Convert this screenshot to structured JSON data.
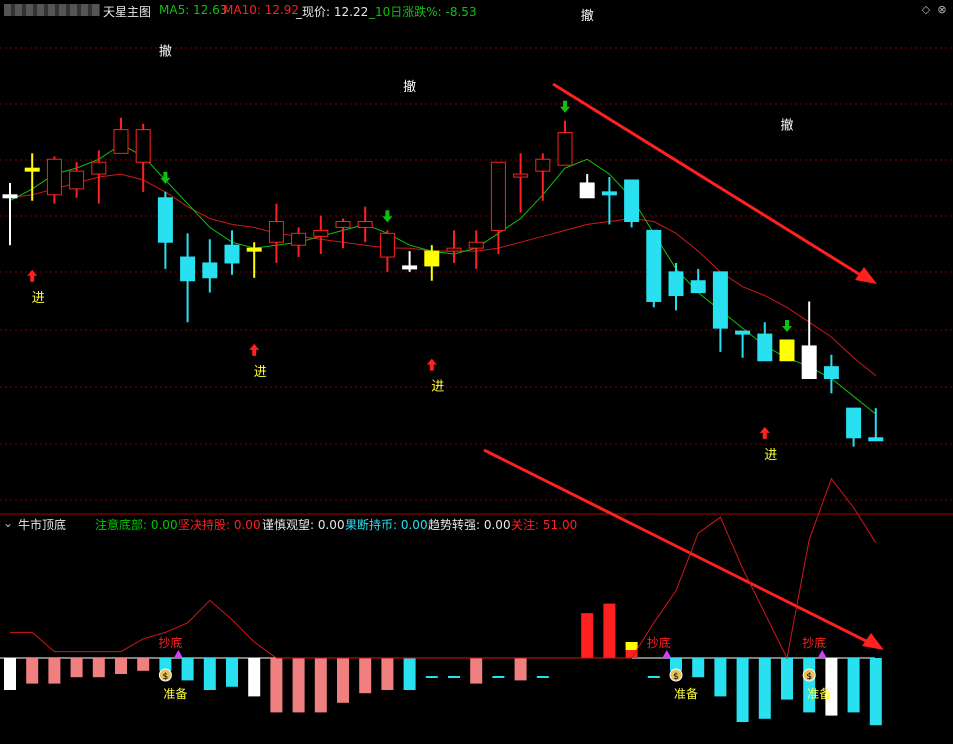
{
  "header": {
    "title": "天星主图",
    "ma5": "MA5: 12.63",
    "ma10": "MA10: 12.92",
    "price": "_现价: 12.22",
    "change10": "_10日涨跌%: -8.53",
    "icon_toggle": "diamond-icon",
    "icon_close": "close-icon"
  },
  "sub_header": {
    "title": "牛市顶底",
    "items": [
      {
        "text": "注意底部: 0.00",
        "color": "#00c800"
      },
      {
        "text": "坚决持股: 0.00",
        "color": "#ff2020"
      },
      {
        "text": "谨慎观望: 0.00",
        "color": "#e8e8e8"
      },
      {
        "text": "果断持币: 0.00",
        "color": "#28e0f0"
      },
      {
        "text": "趋势转强: 0.00",
        "color": "#e8e8e8"
      },
      {
        "text": "关注: 51.00",
        "color": "#ff2020"
      }
    ]
  },
  "labels": {
    "buy": "进",
    "sell": "撤",
    "bottom": "抄底",
    "ready": "准备"
  },
  "colors": {
    "up": "#ff2020",
    "down": "#28e0f0",
    "flat_white": "#ffffff",
    "flat_yellow": "#ffff00",
    "ma5": "#10c010",
    "ma10": "#d01818",
    "pink": "#f08080",
    "grid": "#880000"
  },
  "chart_data": [
    {
      "type": "candlestick",
      "name": "天星主图",
      "candles": [
        {
          "o": 12.33,
          "h": 12.37,
          "l": 12.16,
          "c": 12.33,
          "k": "w"
        },
        {
          "o": 12.42,
          "h": 12.47,
          "l": 12.31,
          "c": 12.42,
          "k": "y"
        },
        {
          "o": 12.33,
          "h": 12.46,
          "l": 12.3,
          "c": 12.45,
          "k": "u"
        },
        {
          "o": 12.35,
          "h": 12.44,
          "l": 12.32,
          "c": 12.41,
          "k": "u"
        },
        {
          "o": 12.4,
          "h": 12.48,
          "l": 12.3,
          "c": 12.44,
          "k": "u"
        },
        {
          "o": 12.47,
          "h": 12.59,
          "l": 12.47,
          "c": 12.55,
          "k": "u"
        },
        {
          "o": 12.44,
          "h": 12.57,
          "l": 12.34,
          "c": 12.55,
          "k": "u"
        },
        {
          "o": 12.32,
          "h": 12.34,
          "l": 12.08,
          "c": 12.17,
          "k": "d"
        },
        {
          "o": 12.12,
          "h": 12.2,
          "l": 11.9,
          "c": 12.04,
          "k": "d"
        },
        {
          "o": 12.1,
          "h": 12.18,
          "l": 12.0,
          "c": 12.05,
          "k": "d"
        },
        {
          "o": 12.16,
          "h": 12.21,
          "l": 12.06,
          "c": 12.1,
          "k": "d"
        },
        {
          "o": 12.15,
          "h": 12.17,
          "l": 12.05,
          "c": 12.15,
          "k": "y"
        },
        {
          "o": 12.17,
          "h": 12.3,
          "l": 12.1,
          "c": 12.24,
          "k": "u"
        },
        {
          "o": 12.16,
          "h": 12.22,
          "l": 12.12,
          "c": 12.2,
          "k": "u"
        },
        {
          "o": 12.19,
          "h": 12.26,
          "l": 12.13,
          "c": 12.21,
          "k": "u"
        },
        {
          "o": 12.22,
          "h": 12.25,
          "l": 12.15,
          "c": 12.24,
          "k": "u"
        },
        {
          "o": 12.22,
          "h": 12.29,
          "l": 12.17,
          "c": 12.24,
          "k": "u"
        },
        {
          "o": 12.12,
          "h": 12.21,
          "l": 12.07,
          "c": 12.2,
          "k": "u"
        },
        {
          "o": 12.09,
          "h": 12.14,
          "l": 12.07,
          "c": 12.09,
          "k": "w"
        },
        {
          "o": 12.09,
          "h": 12.16,
          "l": 12.04,
          "c": 12.14,
          "k": "y"
        },
        {
          "o": 12.14,
          "h": 12.21,
          "l": 12.1,
          "c": 12.15,
          "k": "u"
        },
        {
          "o": 12.15,
          "h": 12.21,
          "l": 12.08,
          "c": 12.17,
          "k": "u"
        },
        {
          "o": 12.21,
          "h": 12.44,
          "l": 12.13,
          "c": 12.44,
          "k": "u"
        },
        {
          "o": 12.4,
          "h": 12.47,
          "l": 12.27,
          "c": 12.4,
          "k": "u"
        },
        {
          "o": 12.41,
          "h": 12.47,
          "l": 12.31,
          "c": 12.45,
          "k": "u"
        },
        {
          "o": 12.43,
          "h": 12.58,
          "l": 12.43,
          "c": 12.54,
          "k": "u"
        },
        {
          "o": 12.32,
          "h": 12.4,
          "l": 12.32,
          "c": 12.37,
          "k": "w"
        },
        {
          "o": 12.34,
          "h": 12.39,
          "l": 12.23,
          "c": 12.34,
          "k": "d"
        },
        {
          "o": 12.38,
          "h": 12.38,
          "l": 12.22,
          "c": 12.24,
          "k": "d"
        },
        {
          "o": 12.21,
          "h": 12.21,
          "l": 11.95,
          "c": 11.97,
          "k": "d"
        },
        {
          "o": 12.07,
          "h": 12.1,
          "l": 11.94,
          "c": 11.99,
          "k": "d"
        },
        {
          "o": 12.04,
          "h": 12.08,
          "l": 12.0,
          "c": 12.0,
          "k": "d"
        },
        {
          "o": 12.07,
          "h": 12.07,
          "l": 11.8,
          "c": 11.88,
          "k": "d"
        },
        {
          "o": 11.87,
          "h": 11.87,
          "l": 11.78,
          "c": 11.87,
          "k": "d"
        },
        {
          "o": 11.86,
          "h": 11.9,
          "l": 11.86,
          "c": 11.77,
          "k": "d"
        },
        {
          "o": 11.84,
          "h": 11.84,
          "l": 11.84,
          "c": 11.77,
          "k": "y"
        },
        {
          "o": 11.82,
          "h": 11.97,
          "l": 11.71,
          "c": 11.71,
          "k": "w"
        },
        {
          "o": 11.75,
          "h": 11.79,
          "l": 11.66,
          "c": 11.71,
          "k": "d"
        },
        {
          "o": 11.61,
          "h": 11.61,
          "l": 11.48,
          "c": 11.51,
          "k": "d"
        },
        {
          "o": 11.51,
          "h": 11.61,
          "l": 11.51,
          "c": 11.51,
          "k": "d"
        }
      ],
      "ma5": [
        12.31,
        12.35,
        12.4,
        12.42,
        12.45,
        12.5,
        12.46,
        12.38,
        12.3,
        12.22,
        12.17,
        12.15,
        12.16,
        12.17,
        12.19,
        12.21,
        12.23,
        12.2,
        12.16,
        12.14,
        12.13,
        12.15,
        12.2,
        12.25,
        12.33,
        12.42,
        12.45,
        12.4,
        12.32,
        12.2,
        12.08,
        12.0,
        11.94,
        11.88,
        11.82,
        11.78,
        11.75,
        11.71,
        11.65,
        11.59
      ],
      "ma10": [
        12.32,
        12.33,
        12.35,
        12.37,
        12.39,
        12.4,
        12.38,
        12.34,
        12.29,
        12.25,
        12.23,
        12.22,
        12.2,
        12.19,
        12.18,
        12.17,
        12.16,
        12.15,
        12.15,
        12.14,
        12.14,
        12.14,
        12.15,
        12.17,
        12.19,
        12.21,
        12.23,
        12.24,
        12.25,
        12.24,
        12.2,
        12.14,
        12.07,
        12.02,
        11.99,
        11.95,
        11.9,
        11.85,
        11.78,
        11.72
      ],
      "signals": [
        {
          "i": 1,
          "type": "buy",
          "price": 12.05
        },
        {
          "i": 7,
          "type": "sell",
          "price": 12.8
        },
        {
          "i": 11,
          "type": "buy",
          "price": 11.8
        },
        {
          "i": 18,
          "type": "sell",
          "price": 12.68
        },
        {
          "i": 19,
          "type": "buy",
          "price": 11.75
        },
        {
          "i": 26,
          "type": "sell",
          "price": 12.92
        },
        {
          "i": 35,
          "type": "sell",
          "price": 12.55
        },
        {
          "i": 34,
          "type": "buy",
          "price": 11.52
        }
      ],
      "down_markers": [
        7,
        17,
        25,
        35
      ],
      "price_range": [
        11.3,
        12.92
      ]
    },
    {
      "type": "bar",
      "name": "牛市顶底",
      "values": [
        -10,
        -8,
        -8,
        -6,
        -6,
        -5,
        -4,
        -4,
        -7,
        -10,
        -9,
        -12,
        -17,
        -17,
        -17,
        -14,
        -11,
        -10,
        -10,
        -2,
        -2,
        -8,
        -2,
        -7,
        -2,
        0,
        14,
        17,
        5,
        -2,
        -4,
        -6,
        -12,
        -20,
        -19,
        -13,
        -17,
        -18,
        -17,
        -21
      ],
      "bar_kinds": [
        "w",
        "p",
        "p",
        "p",
        "p",
        "p",
        "p",
        "d",
        "d",
        "d",
        "d",
        "w",
        "p",
        "p",
        "p",
        "p",
        "p",
        "p",
        "d",
        "d",
        "d",
        "p",
        "d",
        "p",
        "d",
        "u",
        "u",
        "u",
        "y",
        "d",
        "d",
        "d",
        "d",
        "d",
        "d",
        "d",
        "d",
        "w",
        "d",
        "d"
      ],
      "line": [
        8,
        8,
        2,
        2,
        2,
        2,
        6,
        8,
        11,
        18,
        12,
        5,
        0,
        0,
        0,
        0,
        0,
        0,
        0,
        0,
        0,
        0,
        0,
        0,
        0,
        0,
        0,
        0,
        0,
        11,
        21,
        39,
        44,
        28,
        14,
        0,
        37,
        56,
        47,
        36
      ],
      "markers": {
        "bottom_at": [
          7,
          29,
          36
        ],
        "ready_at": [
          7,
          30,
          36
        ]
      },
      "value_range": [
        -30,
        60
      ]
    }
  ]
}
